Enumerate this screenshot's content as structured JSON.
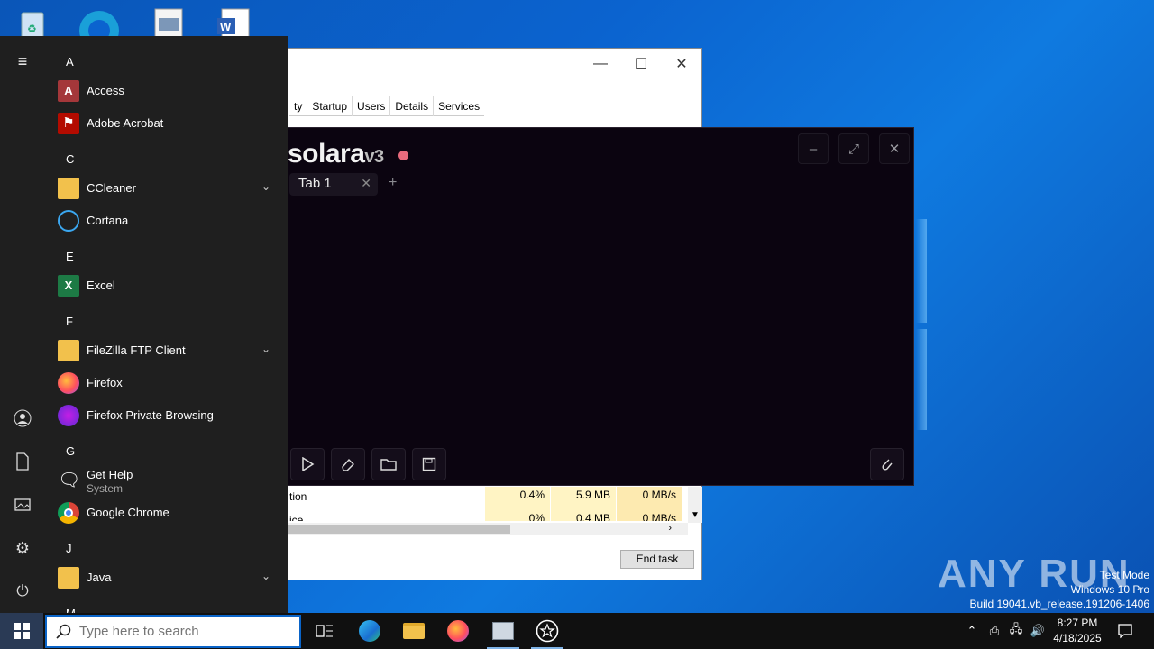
{
  "desktop": {
    "icons": [
      "recycle-bin-icon",
      "edge-icon",
      "document-icon",
      "word-icon"
    ]
  },
  "task_manager": {
    "tabs": [
      "ty",
      "Startup",
      "Users",
      "Details",
      "Services"
    ],
    "rows": [
      {
        "name": "tion",
        "cpu": "0.4%",
        "memory": "5.9 MB",
        "disk": "0 MB/s"
      },
      {
        "name": "ice",
        "cpu": "0%",
        "memory": "0.4 MB",
        "disk": "0 MB/s"
      }
    ],
    "end_task_label": "End task"
  },
  "solara": {
    "logo_text": "solara",
    "logo_version": "v3",
    "tab_label": "Tab 1"
  },
  "start_menu": {
    "groups": [
      {
        "letter": "A",
        "apps": [
          {
            "name": "Access"
          },
          {
            "name": "Adobe Acrobat"
          }
        ]
      },
      {
        "letter": "C",
        "apps": [
          {
            "name": "CCleaner"
          },
          {
            "name": "Cortana"
          }
        ]
      },
      {
        "letter": "E",
        "apps": [
          {
            "name": "Excel"
          }
        ]
      },
      {
        "letter": "F",
        "apps": [
          {
            "name": "FileZilla FTP Client"
          },
          {
            "name": "Firefox"
          },
          {
            "name": "Firefox Private Browsing"
          }
        ]
      },
      {
        "letter": "G",
        "apps": [
          {
            "name": "Get Help",
            "subtitle": "System"
          },
          {
            "name": "Google Chrome"
          }
        ]
      },
      {
        "letter": "J",
        "apps": [
          {
            "name": "Java"
          }
        ]
      },
      {
        "letter": "M"
      }
    ]
  },
  "taskbar": {
    "search_placeholder": "Type here to search",
    "clock_time": "8:27 PM",
    "clock_date": "4/18/2025"
  },
  "watermark": {
    "brand": "ANY RUN",
    "line1": "Test Mode",
    "line2": "Windows 10 Pro",
    "line3": "Build 19041.vb_release.191206-1406"
  },
  "colors": {
    "desktop_blue": "#0b63cf",
    "start_bg": "#1f1f1f",
    "solara_bg": "#0b0410",
    "solara_dot": "#e76a7c",
    "task_manager_cell": "#fff4c4"
  }
}
